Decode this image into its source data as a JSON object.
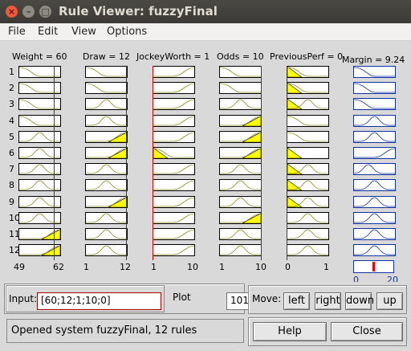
{
  "window": {
    "title": "Rule Viewer: fuzzyFinal"
  },
  "menu": [
    "File",
    "Edit",
    "View",
    "Options"
  ],
  "inputs": [
    {
      "label": "Weight = 60",
      "range_min": "49",
      "range_max": "62"
    },
    {
      "label": "Draw = 12",
      "range_min": "1",
      "range_max": "12"
    },
    {
      "label": "JockeyWorth = 1",
      "range_min": "1",
      "range_max": "10"
    },
    {
      "label": "Odds = 10",
      "range_min": "1",
      "range_max": "10"
    },
    {
      "label": "PreviousPerf = 0",
      "range_min": "0",
      "range_max": "1"
    }
  ],
  "output": {
    "label": "Margin = 9.24",
    "range_min": "0",
    "range_max": "20"
  },
  "rules": [
    "1",
    "2",
    "3",
    "4",
    "5",
    "6",
    "7",
    "8",
    "9",
    "10",
    "11",
    "12"
  ],
  "controls": {
    "input_label": "Input:",
    "input_value": "[60;12;1;10;0]",
    "plot_label": "Plot",
    "plot_value": "101",
    "move_label": "Move:",
    "left": "left",
    "right": "right",
    "down": "down",
    "up": "up"
  },
  "status": "Opened system fuzzyFinal, 12 rules",
  "buttons": {
    "help": "Help",
    "close": "Close"
  },
  "colors": {
    "fill": "#ffff00",
    "indicator": "#d00000",
    "output_border": "#1030a0"
  }
}
